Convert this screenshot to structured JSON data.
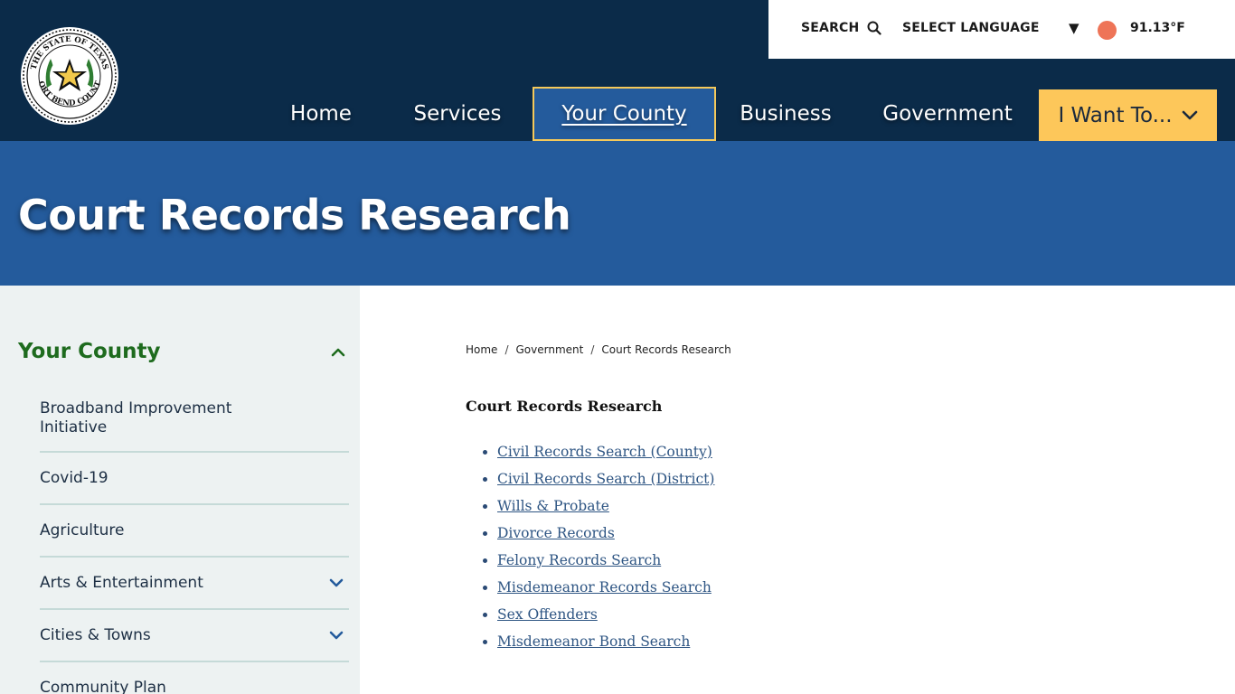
{
  "logo": {
    "seal_text_top": "THE STATE OF TEXAS",
    "seal_text_bottom": "FORT BEND COUNTY"
  },
  "utility": {
    "search_label": "SEARCH",
    "language_label": "SELECT LANGUAGE",
    "language_caret": "▼",
    "temperature": "91.13°F",
    "weather_color": "#ee7457"
  },
  "nav": {
    "items": [
      "Home",
      "Services",
      "Your County",
      "Business",
      "Government"
    ],
    "cta_label": "I Want To...",
    "active_index": 2
  },
  "banner": {
    "title": "Court Records Research"
  },
  "sidebar": {
    "title": "Your County",
    "items": [
      {
        "label": "Broadband Improvement Initiative",
        "expandable": false
      },
      {
        "label": "Covid-19",
        "expandable": false
      },
      {
        "label": "Agriculture",
        "expandable": false
      },
      {
        "label": "Arts & Entertainment",
        "expandable": true
      },
      {
        "label": "Cities & Towns",
        "expandable": true
      },
      {
        "label": "Community Plan",
        "expandable": false
      }
    ]
  },
  "breadcrumb": {
    "items": [
      "Home",
      "Government",
      "Court Records Research"
    ],
    "separator": "/"
  },
  "content": {
    "title": "Court Records Research",
    "links": [
      "Civil Records Search (County)",
      "Civil Records Search (District)",
      "Wills & Probate",
      "Divorce Records",
      "Felony Records Search",
      "Misdemeanor Records Search",
      "Sex Offenders",
      "Misdemeanor Bond Search"
    ]
  },
  "colors": {
    "header_bg": "#0b2b49",
    "banner_bg": "#245b9c",
    "cta_bg": "#fdc75a",
    "sidebar_bg": "#edf2f2",
    "sidebar_title": "#1e6b1e",
    "link": "#2e5583"
  }
}
